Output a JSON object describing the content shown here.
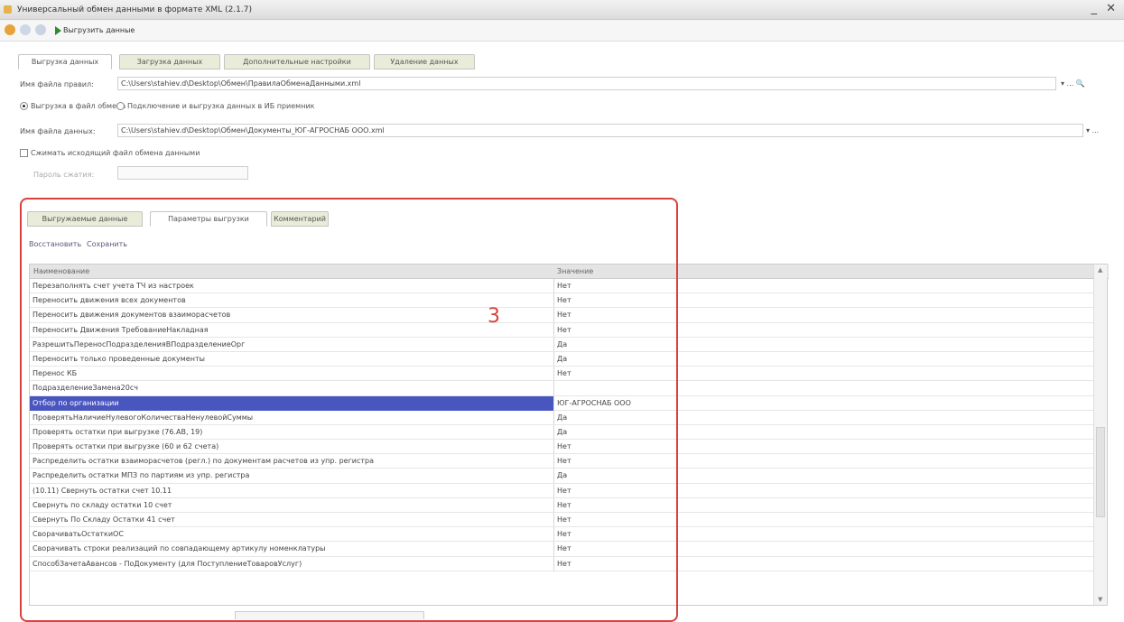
{
  "window": {
    "title": "Универсальный обмен данными в формате XML (2.1.7)",
    "controls": "_ ✕"
  },
  "toolbar": {
    "run_label": "Выгрузить данные"
  },
  "main_tabs": [
    "Выгрузка данных",
    "Загрузка данных",
    "Дополнительные настройки",
    "Удаление данных"
  ],
  "rules_file": {
    "label": "Имя файла правил:",
    "value": "C:\\Users\\stahiev.d\\Desktop\\Обмен\\ПравилаОбменаДанными.xml"
  },
  "mode": {
    "option1": "Выгрузка в файл обмена",
    "option2": "Подключение и выгрузка данных в ИБ приемник"
  },
  "data_file": {
    "label": "Имя файла данных:",
    "value": "C:\\Users\\stahiev.d\\Desktop\\Обмен\\Документы_ЮГ-АГРОСНАБ ООО.xml"
  },
  "compress": {
    "label": "Сжимать исходящий файл обмена данными"
  },
  "password": {
    "label": "Пароль сжатия:"
  },
  "inner_tabs": [
    "Выгружаемые данные",
    "Параметры выгрузки",
    "Комментарий"
  ],
  "links": {
    "restore": "Восстановить",
    "save": "Сохранить"
  },
  "grid": {
    "col_name": "Наименование",
    "col_value": "Значение",
    "rows": [
      {
        "name": "Перезаполнять счет учета ТЧ из настроек",
        "value": "Нет"
      },
      {
        "name": "Переносить движения всех документов",
        "value": "Нет"
      },
      {
        "name": "Переносить движения документов взаиморасчетов",
        "value": "Нет"
      },
      {
        "name": "Переносить Движения ТребованиеНакладная",
        "value": "Нет"
      },
      {
        "name": "РазрешитьПереносПодразделенияВПодразделениеОрг",
        "value": "Да"
      },
      {
        "name": "Переносить только проведенные документы",
        "value": "Да"
      },
      {
        "name": "Перенос КБ",
        "value": "Нет"
      },
      {
        "name": "ПодразделениеЗамена20сч",
        "value": ""
      },
      {
        "name": "Отбор по организации",
        "value": "ЮГ-АГРОСНАБ ООО"
      },
      {
        "name": "ПроверятьНаличиеНулевогоКоличестваНенулевойСуммы",
        "value": "Да"
      },
      {
        "name": "Проверять остатки при выгрузке (76.АВ, 19)",
        "value": "Да"
      },
      {
        "name": "Проверять остатки при выгрузке (60 и 62 счета)",
        "value": "Нет"
      },
      {
        "name": "Распределить остатки взаиморасчетов (регл.) по документам расчетов из упр. регистра",
        "value": "Нет"
      },
      {
        "name": "Распределить остатки МПЗ по партиям из упр. регистра",
        "value": "Да"
      },
      {
        "name": "(10.11) Свернуть остатки счет 10.11",
        "value": "Нет"
      },
      {
        "name": "Свернуть по складу остатки 10 счет",
        "value": "Нет"
      },
      {
        "name": "Свернуть По Складу Остатки 41 счет",
        "value": "Нет"
      },
      {
        "name": "СворачиватьОстаткиОС",
        "value": "Нет"
      },
      {
        "name": "Сворачивать строки реализаций по совпадающему артикулу номенклатуры",
        "value": "Нет"
      },
      {
        "name": "СпособЗачетаАвансов - ПоДокументу (для ПоступлениеТоваровУслуг)",
        "value": "Нет"
      }
    ]
  },
  "annotation": "3",
  "colors": {
    "accent_red": "#d9413c",
    "selection": "#4a56c0",
    "tab_inactive": "#e9ecd8"
  }
}
